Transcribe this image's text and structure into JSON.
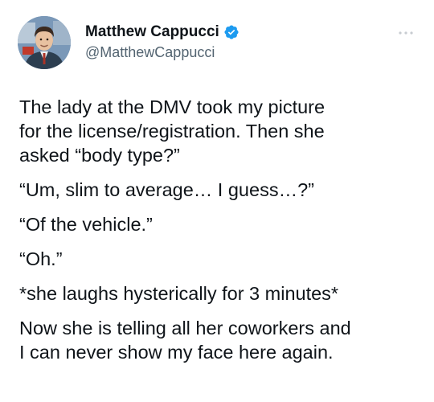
{
  "author": {
    "display_name": "Matthew Cappucci",
    "handle": "@MatthewCappucci",
    "verified": true
  },
  "icons": {
    "avatar": "profile-photo",
    "verified": "verified-badge-icon",
    "more": "more-options-icon"
  },
  "colors": {
    "verified_blue": "#1d9bf0",
    "text": "#0f1419",
    "secondary": "#536471"
  },
  "tweet": {
    "paragraphs": [
      "The lady at the DMV took my picture\nfor the license/registration. Then she\nasked “body type?”",
      "“Um, slim to average… I guess…?”",
      "“Of the vehicle.”",
      "“Oh.”",
      "*she laughs hysterically for 3 minutes*",
      "Now she is telling all her coworkers and\nI can never show my face here again."
    ]
  }
}
